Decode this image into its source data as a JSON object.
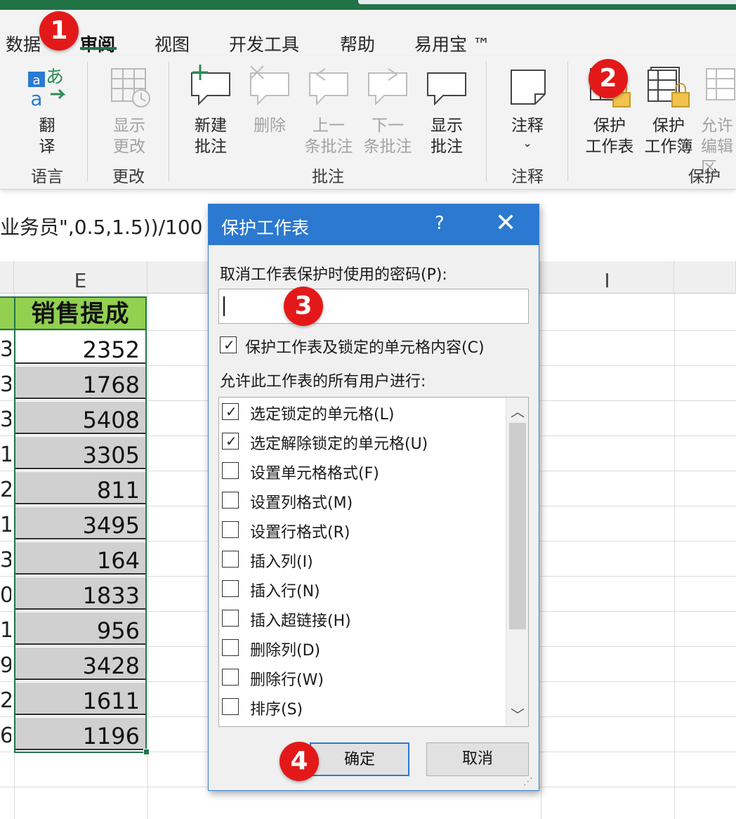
{
  "tabs": [
    "数据",
    "审阅",
    "视图",
    "开发工具",
    "帮助",
    "易用宝 ™"
  ],
  "ribbon": {
    "translate": "翻\n译",
    "show_changes": "显示\n更改",
    "new_comment": "新建\n批注",
    "delete": "删除",
    "prev_comment": "上一\n条批注",
    "next_comment": "下一\n条批注",
    "show_comments": "显示\n批注",
    "notes": "注释",
    "protect_sheet": "保护\n工作表",
    "protect_workbook": "保护\n工作簿",
    "allow_edit": "允许\n编辑区",
    "groups": {
      "language": "语言",
      "changes": "更改",
      "comments": "批注",
      "notes": "注释",
      "protect": "保护"
    }
  },
  "formula_text": "业务员\",0.5,1.5))/100",
  "columns": {
    "e": "E",
    "i": "I"
  },
  "header_cell": "销售提成",
  "sales": [
    "2352",
    "1768",
    "5408",
    "3305",
    "811",
    "3495",
    "164",
    "1833",
    "956",
    "3428",
    "1611",
    "1196"
  ],
  "left_col": [
    "3",
    "3",
    "3",
    "1",
    "2",
    "1",
    "3",
    "0",
    "1",
    "9",
    "2",
    "6"
  ],
  "dialog": {
    "title": "保护工作表",
    "help": "?",
    "close": "✕",
    "password_label": "取消工作表保护时使用的密码(P):",
    "protect_label": "保护工作表及锁定的单元格内容(C)",
    "allow_label": "允许此工作表的所有用户进行:",
    "options": [
      {
        "label": "选定锁定的单元格(L)",
        "checked": true
      },
      {
        "label": "选定解除锁定的单元格(U)",
        "checked": true
      },
      {
        "label": "设置单元格格式(F)",
        "checked": false
      },
      {
        "label": "设置列格式(M)",
        "checked": false
      },
      {
        "label": "设置行格式(R)",
        "checked": false
      },
      {
        "label": "插入列(I)",
        "checked": false
      },
      {
        "label": "插入行(N)",
        "checked": false
      },
      {
        "label": "插入超链接(H)",
        "checked": false
      },
      {
        "label": "删除列(D)",
        "checked": false
      },
      {
        "label": "删除行(W)",
        "checked": false
      },
      {
        "label": "排序(S)",
        "checked": false
      }
    ],
    "ok": "确定",
    "cancel": "取消"
  },
  "markers": [
    "1",
    "2",
    "3",
    "4"
  ],
  "colors": {
    "accent": "#217346",
    "dialog_title": "#2b79d0",
    "marker": "#e31919",
    "header_fill": "#92d050"
  }
}
